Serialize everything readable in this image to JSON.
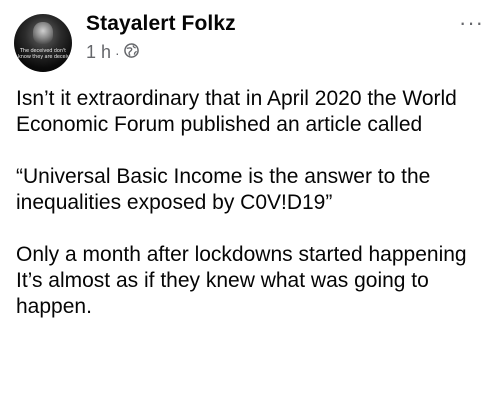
{
  "post": {
    "author_name": "Stayalert Folkz",
    "avatar_caption_line1": "The deceived don't",
    "avatar_caption_line2": "know they are deceived",
    "timestamp": "1 h",
    "separator": "·",
    "privacy_icon": "globe-icon",
    "more_icon": "more-options-icon",
    "more_label": "···",
    "paragraphs": [
      "Isn’t it extraordinary that in April 2020 the World Economic Forum published an article called",
      "“Universal Basic Income is the answer to the inequalities exposed by C0V!D19”",
      "Only a month after lockdowns started happening",
      "It’s almost as if they knew what was going to happen."
    ]
  },
  "colors": {
    "text": "#050505",
    "secondary_text": "#65676b",
    "background": "#ffffff"
  }
}
